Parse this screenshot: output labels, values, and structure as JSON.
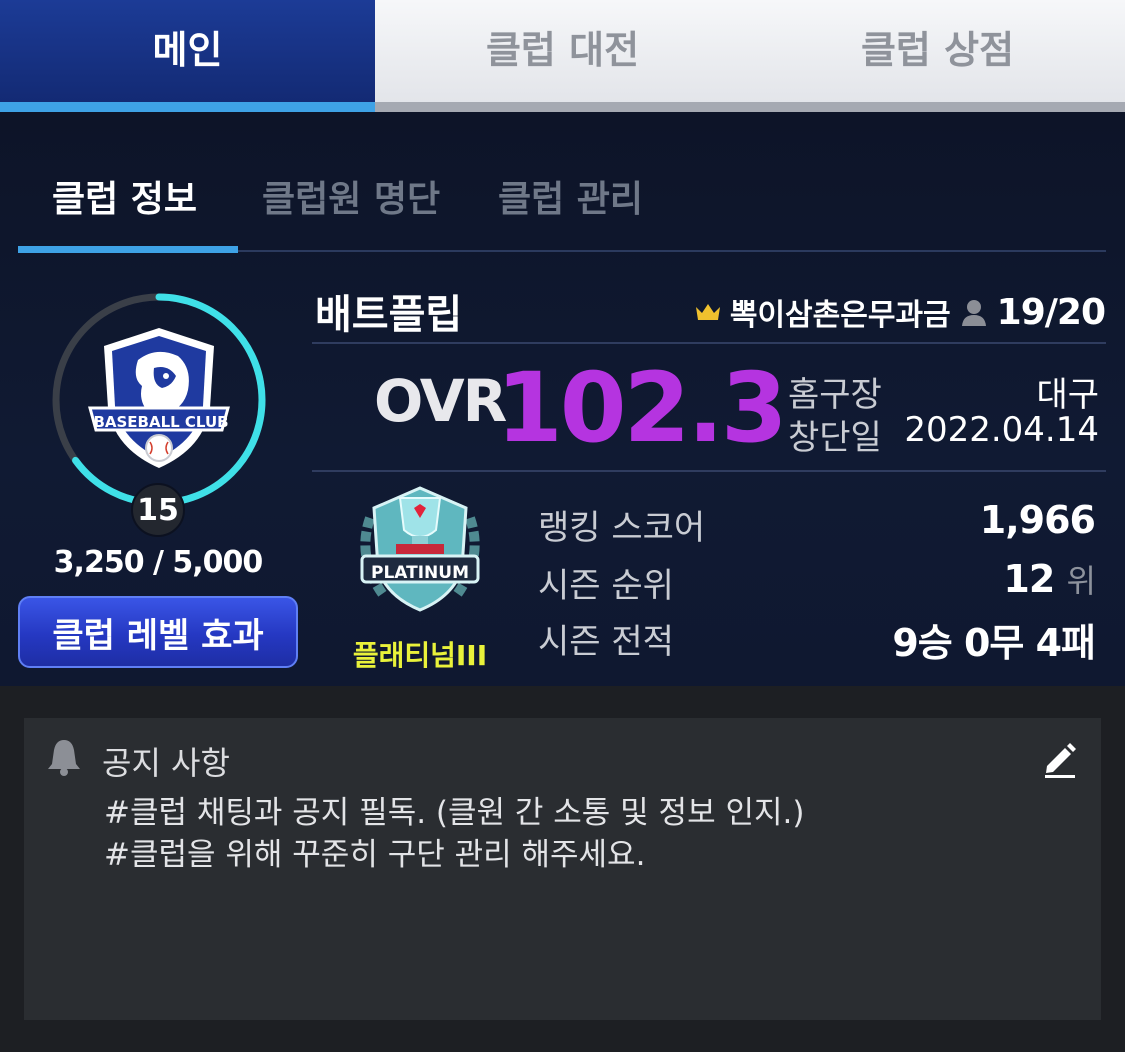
{
  "top_tabs": [
    {
      "label": "메인",
      "active": true
    },
    {
      "label": "클럽 대전",
      "active": false
    },
    {
      "label": "클럽 상점",
      "active": false
    }
  ],
  "sub_tabs": [
    {
      "label": "클럽 정보",
      "active": true
    },
    {
      "label": "클럽원 명단",
      "active": false
    },
    {
      "label": "클럽 관리",
      "active": false
    }
  ],
  "club": {
    "emblem_text": "BASEBALL CLUB",
    "level": "15",
    "exp": "3,250 / 5,000",
    "exp_fraction": 0.65,
    "level_button": "클럽 레벨 효과",
    "name": "배트플립",
    "owner": "뽁이삼촌은무과금",
    "member_count": "19/20",
    "ovr_label": "OVR",
    "ovr_value": "102.3",
    "home_label": "홈구장",
    "home_value": "대구",
    "founded_label": "창단일",
    "founded_value": "2022.04.14",
    "tier_emblem_text": "PLATINUM",
    "tier_label": "플래티넘III",
    "ranking_label": "랭킹 스코어",
    "ranking_value": "1,966",
    "season_rank_label": "시즌 순위",
    "season_rank_value": "12",
    "season_rank_suffix": "위",
    "season_record_label": "시즌 전적",
    "season_record_value": "9승 0무 4패"
  },
  "notice": {
    "title": "공지 사항",
    "body": "#클럽 채팅과 공지 필독. (클원 간 소통 및 정보 인지.)\n#클럽을 위해 꾸준히 구단 관리 해주세요."
  },
  "colors": {
    "accent_blue": "#3ea2e6",
    "ovr_purple": "#b534e0",
    "tier_yellow": "#e9f23a",
    "ring_cyan": "#3fe0e8"
  }
}
